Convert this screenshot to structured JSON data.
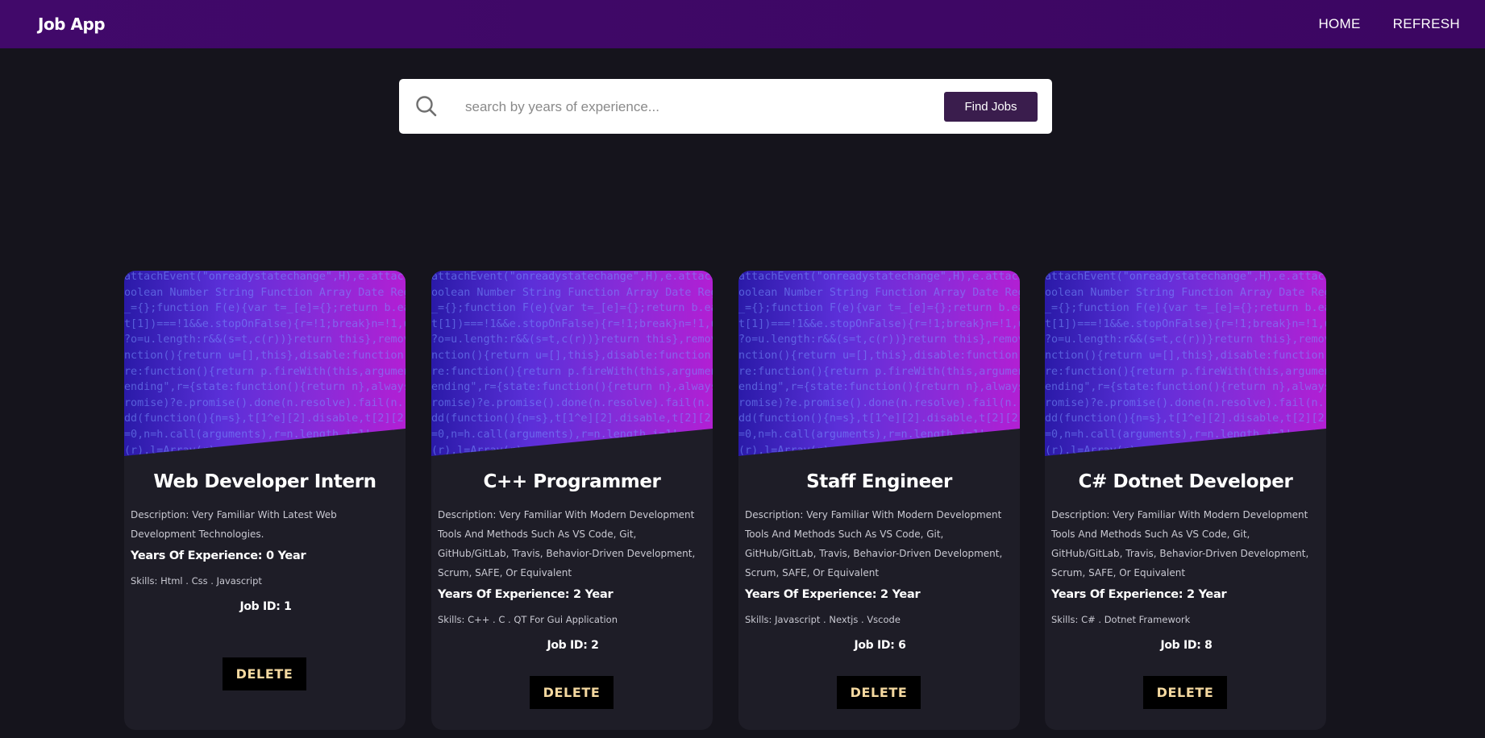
{
  "navbar": {
    "brand": "Job App",
    "links": [
      "HOME",
      "REFRESH"
    ]
  },
  "search": {
    "icon": "search-icon",
    "placeholder": "search by years of experience...",
    "value": "",
    "button_label": "Find Jobs"
  },
  "colors": {
    "navbar": "#3b0764",
    "page_background": "#15141c",
    "card_background": "#1e1d27",
    "button_dark": "#3a1d4d",
    "delete_text": "#f5d9a0"
  },
  "cards": [
    {
      "title": "Web Developer Intern",
      "description": "Description: Very Familiar With Latest Web Development Technologies.",
      "experience": "Years Of Experience: 0 Year",
      "skills": "Skills: Html . Css . Javascript",
      "job_id": "Job ID: 1",
      "delete_label": "DELETE"
    },
    {
      "title": "C++ Programmer",
      "description": "Description: Very Familiar With Modern Development Tools And Methods Such As VS Code, Git, GitHub/GitLab, Travis, Behavior-Driven Development, Scrum, SAFE, Or Equivalent",
      "experience": "Years Of Experience: 2 Year",
      "skills": "Skills: C++ . C . QT For Gui Application",
      "job_id": "Job ID: 2",
      "delete_label": "DELETE"
    },
    {
      "title": "Staff Engineer",
      "description": "Description: Very Familiar With Modern Development Tools And Methods Such As VS Code, Git, GitHub/GitLab, Travis, Behavior-Driven Development, Scrum, SAFE, Or Equivalent",
      "experience": "Years Of Experience: 2 Year",
      "skills": "Skills: Javascript . Nextjs . Vscode",
      "job_id": "Job ID: 6",
      "delete_label": "DELETE"
    },
    {
      "title": "C# Dotnet Developer",
      "description": "Description: Very Familiar With Modern Development Tools And Methods Such As VS Code, Git, GitHub/GitLab, Travis, Behavior-Driven Development, Scrum, SAFE, Or Equivalent",
      "experience": "Years Of Experience: 2 Year",
      "skills": "Skills: C# . Dotnet Framework",
      "job_id": "Job ID: 8",
      "delete_label": "DELETE"
    }
  ]
}
